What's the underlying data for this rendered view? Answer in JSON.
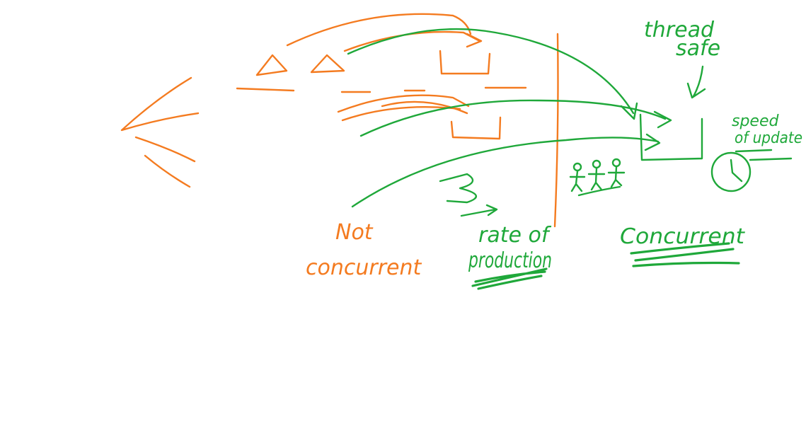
{
  "colors": {
    "orange": "#F47B20",
    "green": "#1FA83A",
    "background": "#FFFFFF"
  },
  "labels": {
    "not_concurrent_line1": "Not",
    "not_concurrent_line2": "concurrent",
    "rate_line1": "rate of",
    "rate_line2": "production",
    "thread_line1": "thread",
    "thread_line2": "safe",
    "speed_line1": "speed",
    "speed_line2": "of update",
    "concurrent": "Concurrent"
  },
  "icons": {
    "people": "people-icon",
    "clock": "clock-icon"
  }
}
